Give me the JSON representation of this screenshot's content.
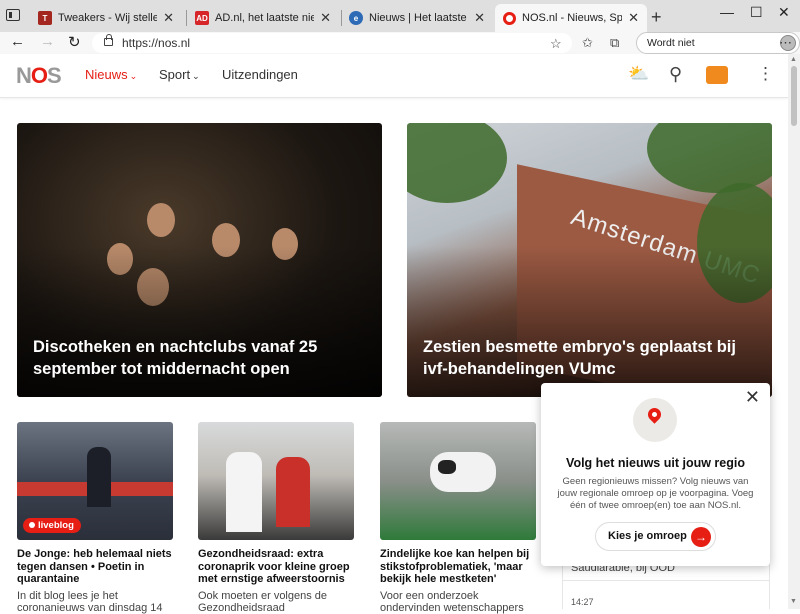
{
  "browser": {
    "tabs": [
      {
        "title": "Tweakers - Wij stellen technolog",
        "favicon_color": "#a3261f",
        "favicon_glyph": "T"
      },
      {
        "title": "AD.nl, het laatste nieuws uit bin",
        "favicon_color": "#d7262a",
        "favicon_glyph": "AD"
      },
      {
        "title": "Nieuws | Het laatste nieuws uit N",
        "favicon_color": "#2d6bb6",
        "favicon_glyph": "e"
      },
      {
        "title": "NOS.nl - Nieuws, Sport en Evene",
        "favicon_color": "#e61e14",
        "favicon_glyph": "o"
      }
    ],
    "active_tab": 3,
    "url": "https://nos.nl",
    "sync_label": "Wordt niet gesynchroniseerd"
  },
  "site": {
    "logo_prefix": "N",
    "logo_o": "O",
    "logo_suffix": "S",
    "nav": [
      {
        "label": "Nieuws",
        "active": true
      },
      {
        "label": "Sport",
        "active": false
      },
      {
        "label": "Uitzendingen",
        "active": false
      }
    ]
  },
  "hero": [
    {
      "title": "Discotheken en nachtclubs vanaf 25 september tot middernacht open"
    },
    {
      "title": "Zestien besmette embryo's geplaatst bij ivf-behandelingen VUmc",
      "image_text": "Amsterdam UMC"
    }
  ],
  "articles": [
    {
      "title": "De Jonge: heb helemaal niets tegen dansen • Poetin in quarantaine",
      "desc": "In dit blog lees je het coronanieuws van dinsdag 14",
      "badge": "liveblog"
    },
    {
      "title": "Gezondheidsraad: extra coronaprik voor kleine groep met ernstige afweerstoornis",
      "desc": "Ook moeten er volgens de Gezondheidsraad"
    },
    {
      "title": "Zindelijke koe kan helpen bij stikstofproblematiek, 'maar bekijk hele mestketen'",
      "desc": "Voor een onderzoek ondervinden wetenschappers"
    }
  ],
  "rightcol": {
    "text": "Saudiarabie, bij OOD",
    "time": "14:27"
  },
  "popup": {
    "title": "Volg het nieuws uit jouw regio",
    "text": "Geen regionieuws missen? Volg nieuws van jouw regionale omroep op je voorpagina. Voeg één of twee omroep(en) toe aan NOS.nl.",
    "button": "Kies je omroep"
  },
  "colors": {
    "brand": "#e61e14"
  }
}
